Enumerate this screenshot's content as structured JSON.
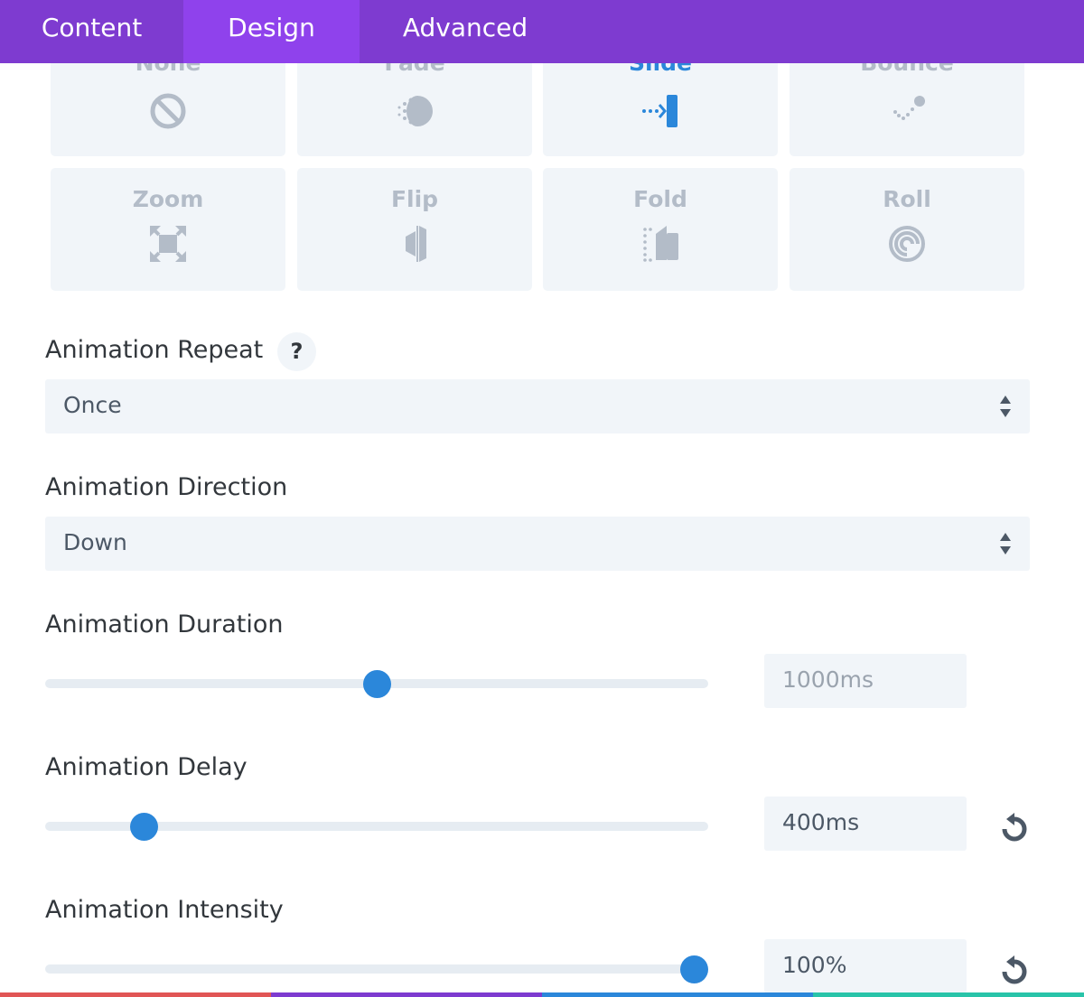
{
  "tabs": [
    {
      "label": "Content"
    },
    {
      "label": "Design",
      "active": true
    },
    {
      "label": "Advanced"
    }
  ],
  "animation_styles": [
    {
      "label": "None",
      "icon": "none-icon"
    },
    {
      "label": "Fade",
      "icon": "fade-icon"
    },
    {
      "label": "Slide",
      "icon": "slide-icon",
      "selected": true
    },
    {
      "label": "Bounce",
      "icon": "bounce-icon"
    },
    {
      "label": "Zoom",
      "icon": "zoom-icon"
    },
    {
      "label": "Flip",
      "icon": "flip-icon"
    },
    {
      "label": "Fold",
      "icon": "fold-icon"
    },
    {
      "label": "Roll",
      "icon": "roll-icon"
    }
  ],
  "animation_repeat": {
    "label": "Animation Repeat",
    "help": "?",
    "value": "Once"
  },
  "animation_direction": {
    "label": "Animation Direction",
    "value": "Down"
  },
  "animation_duration": {
    "label": "Animation Duration",
    "value": "1000ms",
    "slider_fraction": 0.5,
    "is_default": true
  },
  "animation_delay": {
    "label": "Animation Delay",
    "value": "400ms",
    "slider_fraction": 0.148
  },
  "animation_intensity": {
    "label": "Animation Intensity",
    "value": "100%",
    "slider_fraction": 0.978
  },
  "colors": {
    "tab_bar": "#7e3bd0",
    "tab_active": "#8f42ec",
    "accent": "#2b87da",
    "control_bg": "#f1f5f9",
    "muted_icon": "#b3bcc8",
    "strip": [
      "#e15555",
      "#7e3bd0",
      "#2b87da",
      "#29c4a9"
    ]
  }
}
